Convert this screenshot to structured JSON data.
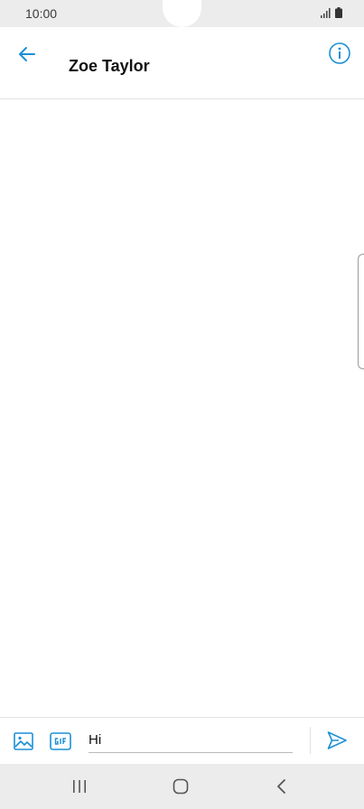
{
  "status_bar": {
    "time": "10:00"
  },
  "app_bar": {
    "title": "Zoe Taylor"
  },
  "composer": {
    "message_value": "Hi"
  },
  "icons": {
    "back": "arrow-left-icon",
    "info": "info-circle-icon",
    "attach": "image-icon",
    "gif": "gif-icon",
    "send": "send-icon"
  },
  "colors": {
    "accent": "#1a8fd6",
    "bar_bg": "#ececec"
  }
}
